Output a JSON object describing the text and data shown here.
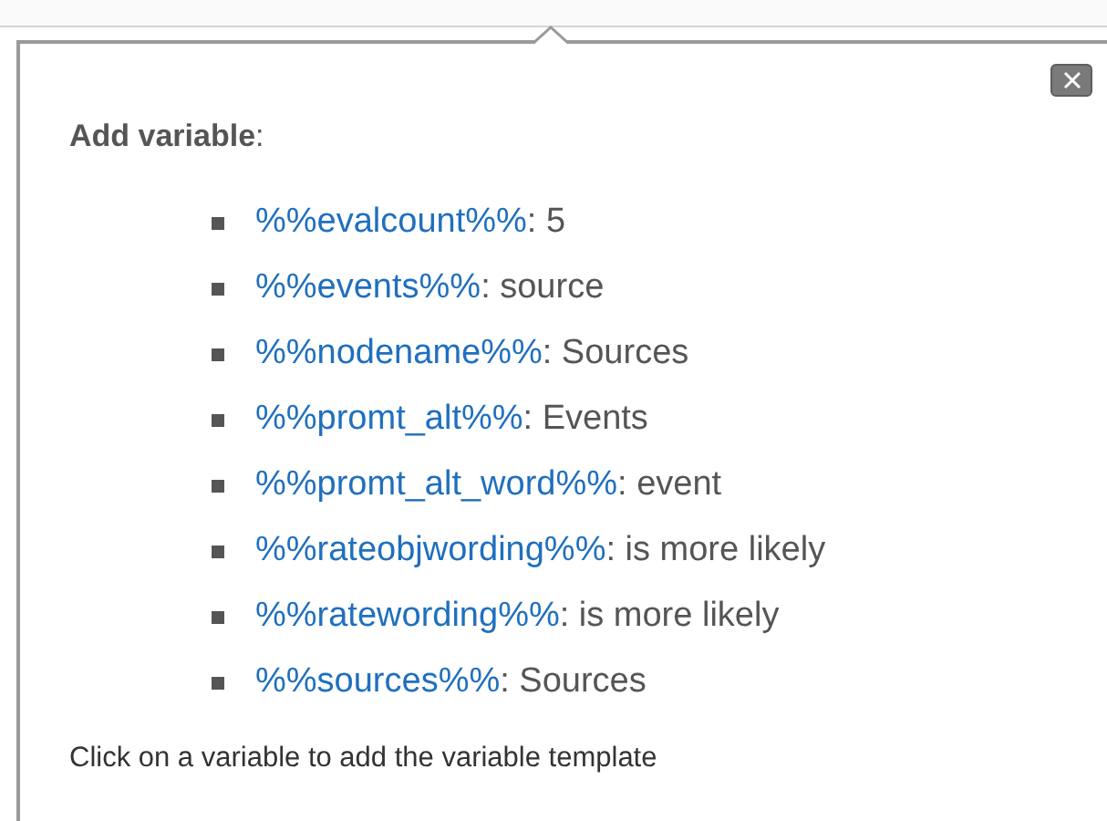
{
  "popup": {
    "title": "**Add variable**:",
    "variables": [
      {
        "name": "%%evalcount%%",
        "value": ": 5"
      },
      {
        "name": "%%events%%",
        "value": ": source"
      },
      {
        "name": "%%nodename%%",
        "value": ": Sources"
      },
      {
        "name": "%%promt_alt%%",
        "value": ": Events"
      },
      {
        "name": "%%promt_alt_word%%",
        "value": ": event"
      },
      {
        "name": "%%rateobjwording%%",
        "value": ": is more likely"
      },
      {
        "name": "%%ratewording%%",
        "value": ": is more likely"
      },
      {
        "name": "%%sources%%",
        "value": ": Sources"
      }
    ],
    "hint": "Click on a variable to add the variable template"
  }
}
